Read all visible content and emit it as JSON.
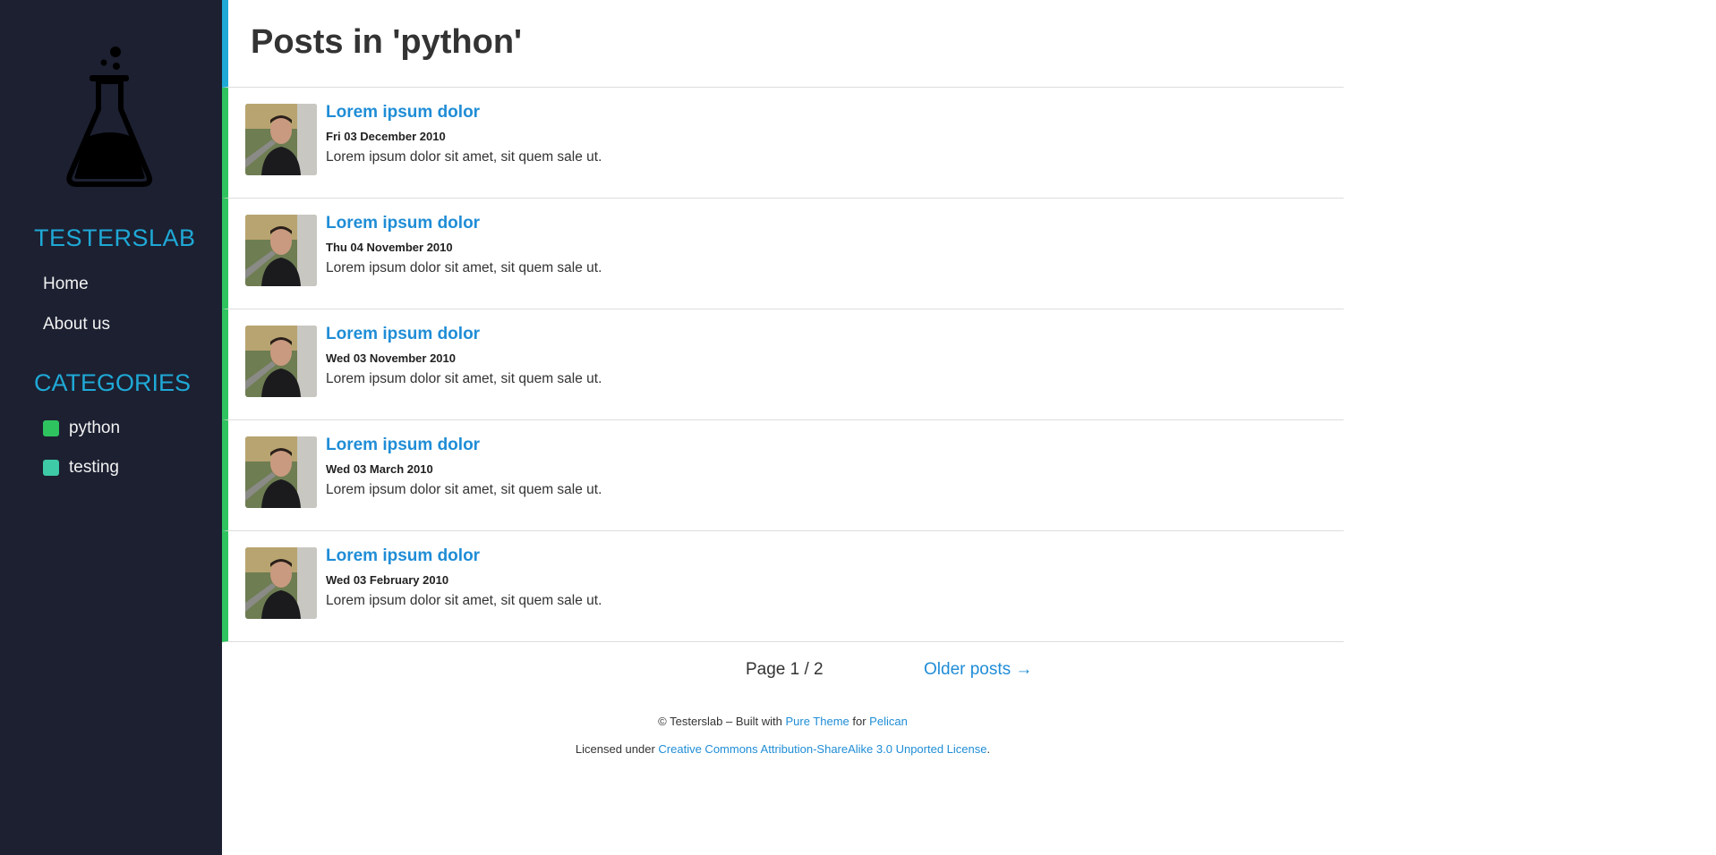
{
  "sidebar": {
    "site_title": "TESTERSLAB",
    "nav": [
      {
        "label": "Home"
      },
      {
        "label": "About us"
      }
    ],
    "categories_heading": "CATEGORIES",
    "categories": [
      {
        "label": "python",
        "color": "#2fc360"
      },
      {
        "label": "testing",
        "color": "#3ec9a7"
      }
    ],
    "logo_icon": "flask-icon"
  },
  "main": {
    "page_title": "Posts in 'python'",
    "posts": [
      {
        "title": "Lorem ipsum dolor",
        "date": "Fri 03 December 2010",
        "summary": "Lorem ipsum dolor sit amet, sit quem sale ut."
      },
      {
        "title": "Lorem ipsum dolor",
        "date": "Thu 04 November 2010",
        "summary": "Lorem ipsum dolor sit amet, sit quem sale ut."
      },
      {
        "title": "Lorem ipsum dolor",
        "date": "Wed 03 November 2010",
        "summary": "Lorem ipsum dolor sit amet, sit quem sale ut."
      },
      {
        "title": "Lorem ipsum dolor",
        "date": "Wed 03 March 2010",
        "summary": "Lorem ipsum dolor sit amet, sit quem sale ut."
      },
      {
        "title": "Lorem ipsum dolor",
        "date": "Wed 03 February 2010",
        "summary": "Lorem ipsum dolor sit amet, sit quem sale ut."
      }
    ],
    "pagination": {
      "page_indicator": "Page 1 / 2",
      "older_label": "Older posts →"
    }
  },
  "footer": {
    "copyright_prefix": "© Testerslab – Built with ",
    "theme_link": "Pure Theme",
    "for_text": " for ",
    "engine_link": "Pelican",
    "license_prefix": "Licensed under ",
    "license_link": "Creative Commons Attribution-ShareAlike 3.0 Unported License",
    "license_suffix": "."
  },
  "colors": {
    "sidebar_bg": "#1c2031",
    "accent": "#1fa9d6",
    "link": "#1f8dd6",
    "post_border": "#2fc360"
  }
}
